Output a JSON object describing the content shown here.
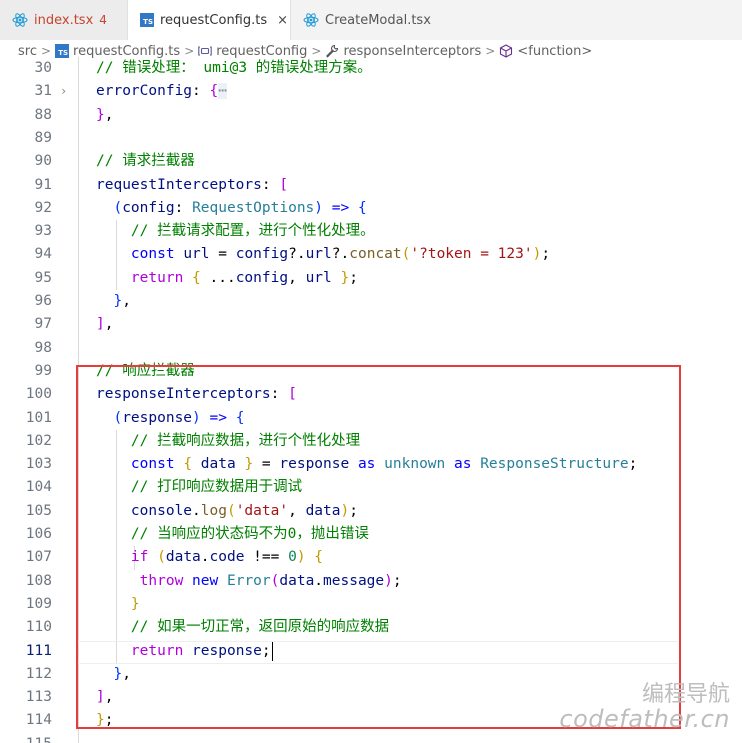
{
  "tabs": [
    {
      "name": "index.tsx",
      "badge": "4",
      "icon": "react-icon"
    },
    {
      "name": "requestConfig.ts",
      "close": "×",
      "icon": "ts-icon"
    },
    {
      "name": "CreateModal.tsx",
      "icon": "react-icon"
    }
  ],
  "breadcrumbs": {
    "src": "src",
    "file": "requestConfig.ts",
    "symbol1": "requestConfig",
    "symbol2": "responseInterceptors",
    "symbol3": "<function>",
    "separator": ">"
  },
  "editor": {
    "lines": [
      {
        "num": "30",
        "tokens": [
          [
            "c",
            "// 错误处理： umi@3 的错误处理方案。"
          ]
        ]
      },
      {
        "num": "31",
        "fold": "›",
        "tokens": [
          [
            "p",
            "errorConfig"
          ],
          [
            "",
            ": "
          ],
          [
            "bm",
            "{"
          ],
          [
            "dots",
            "⋯"
          ]
        ]
      },
      {
        "num": "88",
        "tokens": [
          [
            "bm",
            "}"
          ],
          [
            "",
            ","
          ]
        ]
      },
      {
        "num": "89",
        "tokens": []
      },
      {
        "num": "90",
        "tokens": [
          [
            "c",
            "// 请求拦截器"
          ]
        ]
      },
      {
        "num": "91",
        "tokens": [
          [
            "p",
            "requestInterceptors"
          ],
          [
            "",
            ": "
          ],
          [
            "bm",
            "["
          ]
        ]
      },
      {
        "num": "92",
        "tokens": [
          [
            "",
            "  "
          ],
          [
            "b1",
            "("
          ],
          [
            "p",
            "config"
          ],
          [
            "",
            ": "
          ],
          [
            "t",
            "RequestOptions"
          ],
          [
            "b1",
            ")"
          ],
          [
            "",
            " "
          ],
          [
            "k",
            "=>"
          ],
          [
            "",
            " "
          ],
          [
            "b1",
            "{"
          ]
        ]
      },
      {
        "num": "93",
        "tokens": [
          [
            "",
            "    "
          ],
          [
            "c",
            "// 拦截请求配置，进行个性化处理。"
          ]
        ]
      },
      {
        "num": "94",
        "tokens": [
          [
            "",
            "    "
          ],
          [
            "k",
            "const"
          ],
          [
            "",
            " "
          ],
          [
            "p",
            "url"
          ],
          [
            "",
            " = "
          ],
          [
            "p",
            "config"
          ],
          [
            "",
            "?."
          ],
          [
            "p",
            "url"
          ],
          [
            "",
            "?."
          ],
          [
            "f",
            "concat"
          ],
          [
            "bg",
            "("
          ],
          [
            "s",
            "'?token = 123'"
          ],
          [
            "bg",
            ")"
          ],
          [
            "",
            ";"
          ]
        ]
      },
      {
        "num": "95",
        "tokens": [
          [
            "",
            "    "
          ],
          [
            "ck",
            "return"
          ],
          [
            "",
            " "
          ],
          [
            "bg",
            "{"
          ],
          [
            "",
            " ..."
          ],
          [
            "p",
            "config"
          ],
          [
            "",
            ", "
          ],
          [
            "p",
            "url"
          ],
          [
            "",
            " "
          ],
          [
            "bg",
            "}"
          ],
          [
            "",
            ";"
          ]
        ]
      },
      {
        "num": "96",
        "tokens": [
          [
            "",
            "  "
          ],
          [
            "b1",
            "}"
          ],
          [
            "",
            ","
          ]
        ]
      },
      {
        "num": "97",
        "tokens": [
          [
            "bm",
            "]"
          ],
          [
            "",
            ","
          ]
        ]
      },
      {
        "num": "98",
        "tokens": []
      },
      {
        "num": "99",
        "tokens": [
          [
            "c",
            "// 响应拦截器"
          ]
        ]
      },
      {
        "num": "100",
        "tokens": [
          [
            "p",
            "responseInterceptors"
          ],
          [
            "",
            ": "
          ],
          [
            "bm",
            "["
          ]
        ]
      },
      {
        "num": "101",
        "tokens": [
          [
            "",
            "  "
          ],
          [
            "b1",
            "("
          ],
          [
            "p",
            "response"
          ],
          [
            "b1",
            ")"
          ],
          [
            "",
            " "
          ],
          [
            "k",
            "=>"
          ],
          [
            "",
            " "
          ],
          [
            "b1",
            "{"
          ]
        ]
      },
      {
        "num": "102",
        "tokens": [
          [
            "",
            "    "
          ],
          [
            "c",
            "// 拦截响应数据，进行个性化处理"
          ]
        ]
      },
      {
        "num": "103",
        "tokens": [
          [
            "",
            "    "
          ],
          [
            "k",
            "const"
          ],
          [
            "",
            " "
          ],
          [
            "bg",
            "{"
          ],
          [
            "",
            " "
          ],
          [
            "p",
            "data"
          ],
          [
            "",
            " "
          ],
          [
            "bg",
            "}"
          ],
          [
            "",
            " = "
          ],
          [
            "p",
            "response"
          ],
          [
            "",
            " "
          ],
          [
            "k",
            "as"
          ],
          [
            "",
            " "
          ],
          [
            "t",
            "unknown"
          ],
          [
            "",
            " "
          ],
          [
            "k",
            "as"
          ],
          [
            "",
            " "
          ],
          [
            "t",
            "ResponseStructure"
          ],
          [
            "",
            ";"
          ]
        ]
      },
      {
        "num": "104",
        "tokens": [
          [
            "",
            "    "
          ],
          [
            "c",
            "// 打印响应数据用于调试"
          ]
        ]
      },
      {
        "num": "105",
        "tokens": [
          [
            "",
            "    "
          ],
          [
            "p",
            "console"
          ],
          [
            "",
            "."
          ],
          [
            "f",
            "log"
          ],
          [
            "bg",
            "("
          ],
          [
            "s",
            "'data'"
          ],
          [
            "",
            ", "
          ],
          [
            "p",
            "data"
          ],
          [
            "bg",
            ")"
          ],
          [
            "",
            ";"
          ]
        ]
      },
      {
        "num": "106",
        "tokens": [
          [
            "",
            "    "
          ],
          [
            "c",
            "// 当响应的状态码不为0，抛出错误"
          ]
        ]
      },
      {
        "num": "107",
        "tokens": [
          [
            "",
            "    "
          ],
          [
            "ck",
            "if"
          ],
          [
            "",
            " "
          ],
          [
            "bg",
            "("
          ],
          [
            "p",
            "data"
          ],
          [
            "",
            "."
          ],
          [
            "p",
            "code"
          ],
          [
            "",
            " !== "
          ],
          [
            "n",
            "0"
          ],
          [
            "bg",
            ")"
          ],
          [
            "",
            " "
          ],
          [
            "bg",
            "{"
          ]
        ]
      },
      {
        "num": "108",
        "tokens": [
          [
            "",
            "     "
          ],
          [
            "ck",
            "throw"
          ],
          [
            "",
            " "
          ],
          [
            "k",
            "new"
          ],
          [
            "",
            " "
          ],
          [
            "t",
            "Error"
          ],
          [
            "bm",
            "("
          ],
          [
            "p",
            "data"
          ],
          [
            "",
            "."
          ],
          [
            "p",
            "message"
          ],
          [
            "bm",
            ")"
          ],
          [
            "",
            ";"
          ]
        ]
      },
      {
        "num": "109",
        "tokens": [
          [
            "",
            "    "
          ],
          [
            "bg",
            "}"
          ]
        ]
      },
      {
        "num": "110",
        "tokens": [
          [
            "",
            "    "
          ],
          [
            "c",
            "// 如果一切正常，返回原始的响应数据"
          ]
        ]
      },
      {
        "num": "111",
        "active": true,
        "tokens": [
          [
            "",
            "    "
          ],
          [
            "ck",
            "return"
          ],
          [
            "",
            " "
          ],
          [
            "p",
            "response"
          ],
          [
            "",
            ";"
          ]
        ]
      },
      {
        "num": "112",
        "tokens": [
          [
            "",
            "  "
          ],
          [
            "b1",
            "}"
          ],
          [
            "",
            ","
          ]
        ]
      },
      {
        "num": "113",
        "tokens": [
          [
            "bm",
            "]"
          ],
          [
            "",
            ","
          ]
        ]
      },
      {
        "num": "114",
        "tokens": [
          [
            "bg",
            "}"
          ],
          [
            "",
            ";"
          ]
        ]
      },
      {
        "num": "115",
        "tokens": []
      }
    ]
  },
  "watermark": {
    "line1": "编程导航",
    "line2": "codefather.cn"
  },
  "colors": {
    "highlight_border": "#e53c3c",
    "ts_blue": "#3178c6",
    "react_blue": "#1f9ad6"
  }
}
